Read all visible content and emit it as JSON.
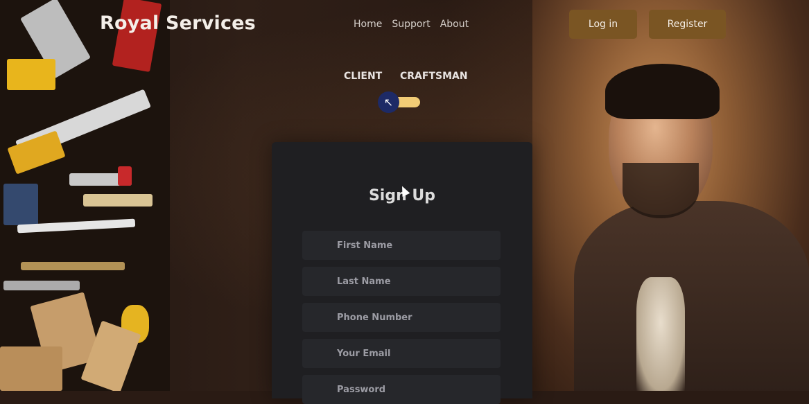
{
  "header": {
    "brand": "Royal Services",
    "nav": [
      "Home",
      "Support",
      "About"
    ],
    "login_label": "Log in",
    "register_label": "Register"
  },
  "role_toggle": {
    "client_label": "CLIENT",
    "craftsman_label": "CRAFTSMAN",
    "knob_icon": "↖"
  },
  "form": {
    "title": "Sign Up",
    "fields": [
      {
        "placeholder": "First Name"
      },
      {
        "placeholder": "Last Name"
      },
      {
        "placeholder": "Phone Number"
      },
      {
        "placeholder": "Your Email"
      },
      {
        "placeholder": "Password"
      }
    ]
  },
  "colors": {
    "accent_button": "#7a5523",
    "toggle_track": "#f1cc76",
    "toggle_knob": "#1d2a66",
    "card_bg": "#1f1f22"
  }
}
